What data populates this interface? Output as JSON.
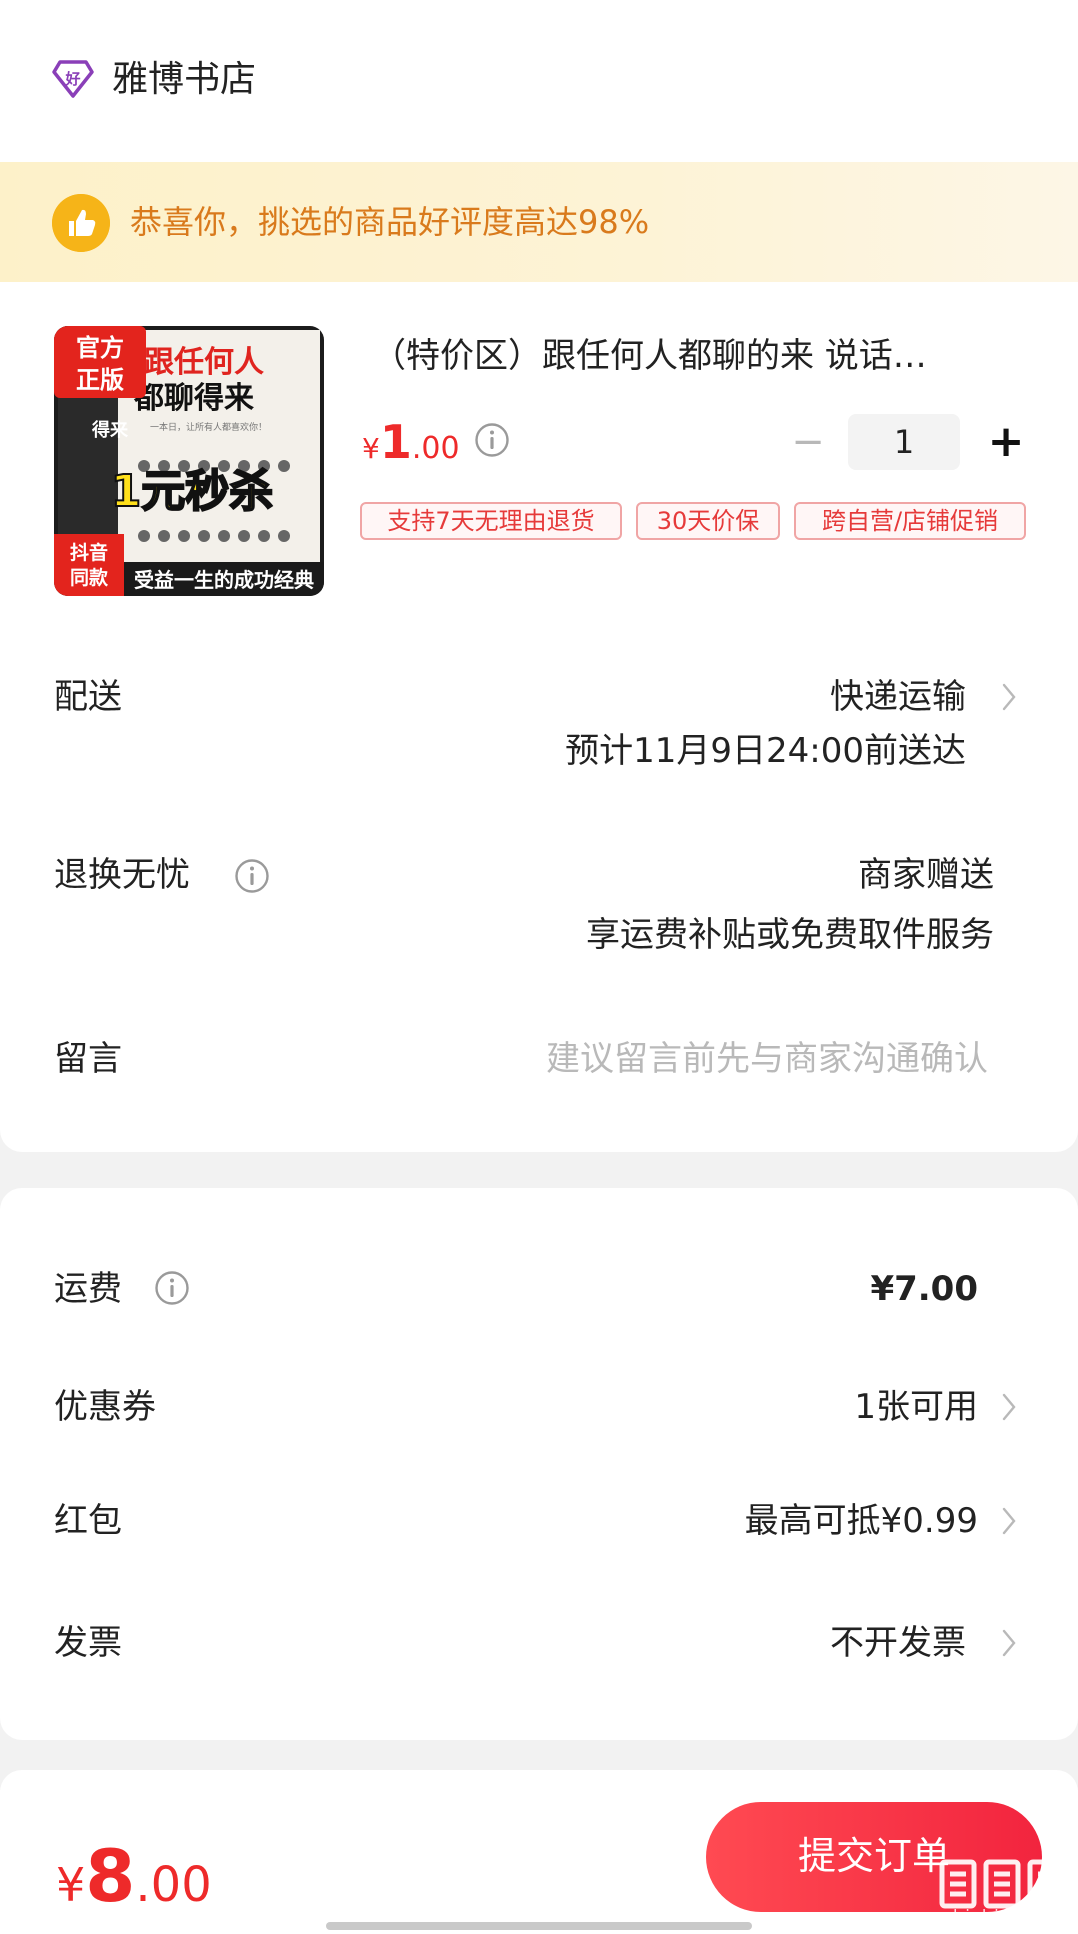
{
  "shop": {
    "name": "雅博书店",
    "logo_icon": "good-shop-diamond-icon",
    "logo_char": "好"
  },
  "banner": {
    "text": "恭喜你，挑选的商品好评度高达98%",
    "icon": "thumbs-up-icon"
  },
  "product": {
    "title": "（特价区）跟任何人都聊的来 说话…",
    "price_symbol": "¥",
    "price_int": "1",
    "price_dec": ".00",
    "quantity": "1",
    "minus": "−",
    "plus": "+",
    "tags": [
      "支持7天无理由退货",
      "30天价保",
      "跨自营/店铺促销"
    ],
    "image": {
      "badge_official": "官方\n正版",
      "cover_title_1": "跟任何人",
      "cover_title_2": "都聊得来",
      "cover_subtitle": "一本日，让所有人都喜欢你！",
      "cover_side": "得来",
      "promo": "1元秒杀",
      "badge_douyin": "抖音\n同款",
      "slogan": "受益一生的成功经典"
    }
  },
  "delivery": {
    "label": "配送",
    "method": "快递运输",
    "eta": "预计11月9日24:00前送达"
  },
  "returns": {
    "label": "退换无忧",
    "value": "商家赠送",
    "detail": "享运费补贴或免费取件服务"
  },
  "message": {
    "label": "留言",
    "placeholder": "建议留言前先与商家沟通确认"
  },
  "fees": {
    "shipping": {
      "label": "运费",
      "value": "¥7.00"
    },
    "coupon": {
      "label": "优惠券",
      "value": "1张可用"
    },
    "red_packet": {
      "label": "红包",
      "value": "最高可抵¥0.99"
    },
    "invoice": {
      "label": "发票",
      "value": "不开发票"
    }
  },
  "footer": {
    "total_symbol": "¥",
    "total_int": "8",
    "total_dec": ".00",
    "submit_label": "提交订单",
    "watermark_text": "zhizhizhi.com"
  },
  "colors": {
    "price_red": "#ee2a2a",
    "banner_orange": "#d97a1c",
    "button_red": "#f2243e",
    "brand_purple": "#8a3fb8"
  }
}
